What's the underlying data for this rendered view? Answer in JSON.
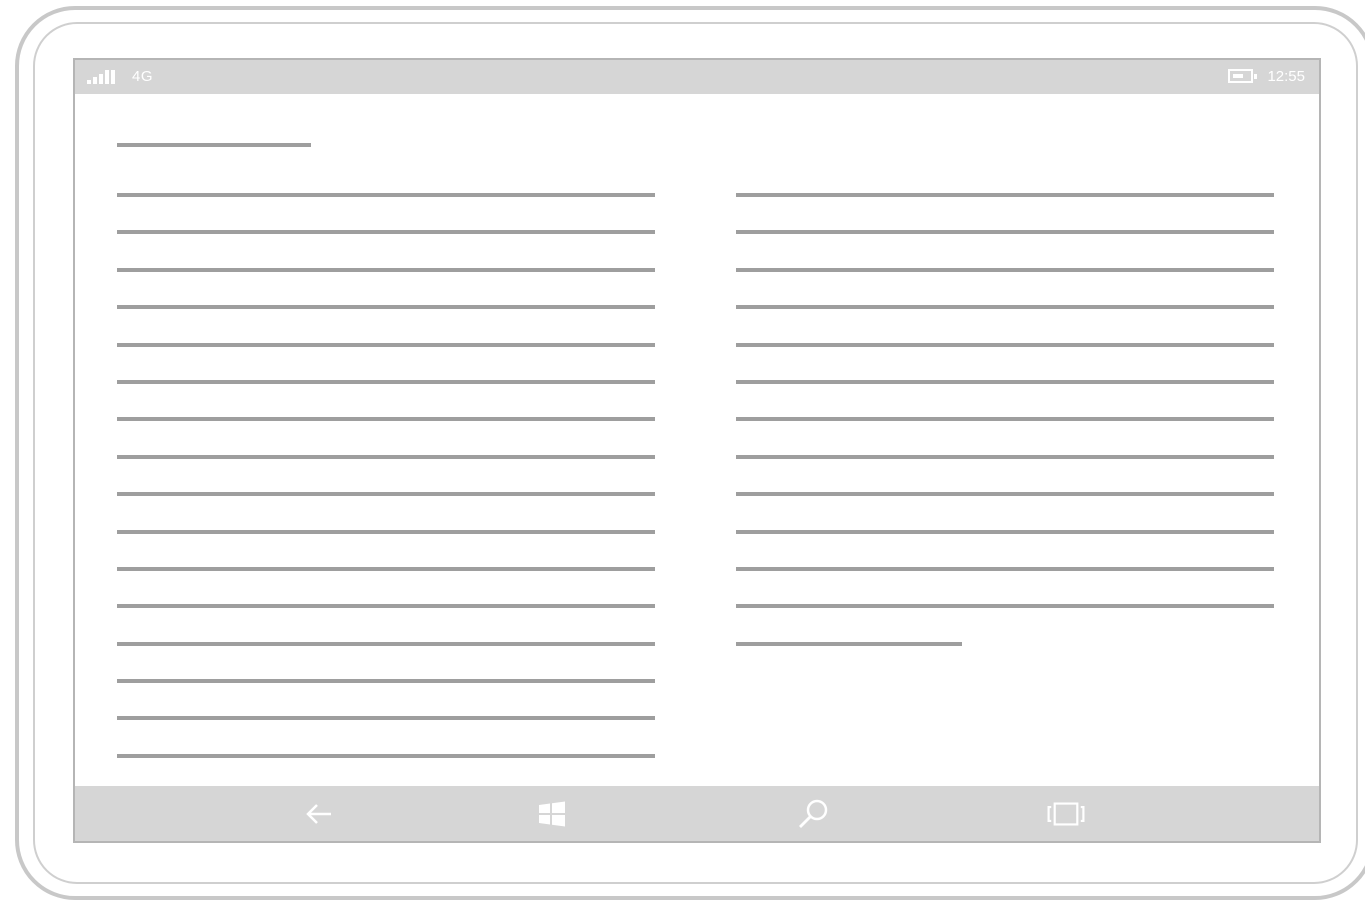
{
  "status_bar": {
    "network": "4G",
    "time": "12:55",
    "signal_icon": "signal-bars-icon",
    "battery_icon": "battery-icon"
  },
  "nav_bar": {
    "buttons": [
      {
        "name": "back-button",
        "icon": "back-arrow-icon"
      },
      {
        "name": "start-button",
        "icon": "windows-logo-icon"
      },
      {
        "name": "search-button",
        "icon": "search-icon"
      },
      {
        "name": "task-view-button",
        "icon": "task-view-icon"
      }
    ]
  },
  "colors": {
    "bar_background": "#d6d6d6",
    "placeholder_line": "#9e9e9e",
    "device_frame": "#c8c8c8"
  }
}
